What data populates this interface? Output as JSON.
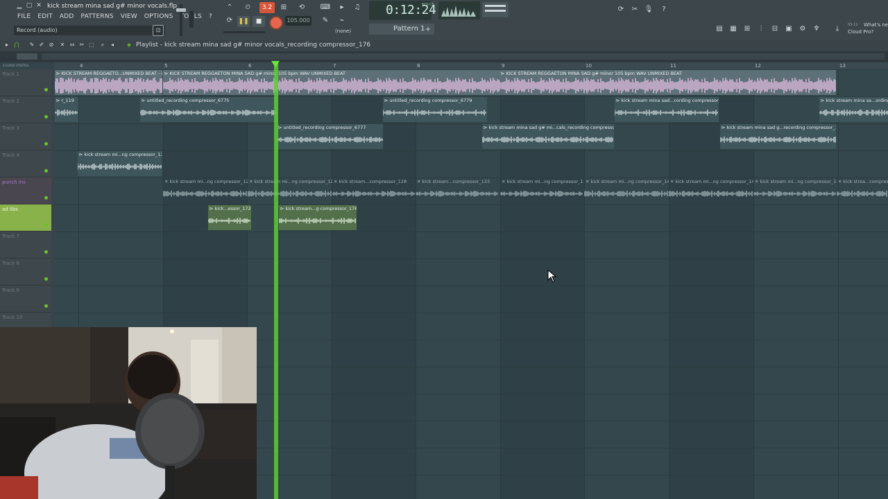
{
  "window": {
    "title": "kick stream mina sad g# minor vocals.flp"
  },
  "menu": [
    "FILE",
    "EDIT",
    "ADD",
    "PATTERNS",
    "VIEW",
    "OPTIONS",
    "TOOLS",
    "?"
  ],
  "hint": "Record (audio)",
  "transport": {
    "time": "0:12:24",
    "time_label": "M:S:CS",
    "tempo": "105.000",
    "snap_value": "3.2",
    "pattern": "Pattern 1",
    "pattern_snap": "(none)"
  },
  "news": {
    "date": "03-11",
    "line1": "What's new",
    "line2": "Cloud Pro?"
  },
  "playlist": {
    "title": "Playlist - kick stream mina sad g# minor vocals_recording compressor_176",
    "bar_numbers": [
      "4",
      "5",
      "6",
      "7",
      "8",
      "9",
      "10",
      "11",
      "12",
      "13"
    ],
    "tracks": [
      {
        "name": "Track 1"
      },
      {
        "name": "Track 2"
      },
      {
        "name": "Track 3"
      },
      {
        "name": "Track 4"
      },
      {
        "name": "punch ins"
      },
      {
        "name": "ad libs"
      },
      {
        "name": "Track 7"
      },
      {
        "name": "Track 8"
      },
      {
        "name": "Track 9"
      },
      {
        "name": "Track 10"
      }
    ],
    "clips": [
      {
        "label": "KICK STREAM REGGAETO...UNMIXED BEAT - intro"
      },
      {
        "label": "KICK STREAM REGGAETON MINA SAD g# minor 105 bpm WAV UNMIXED BEAT"
      },
      {
        "label": "KICK STREAM REGGAETON MINA SAD g# minor 105 bpm WAV UNMIXED BEAT"
      },
      {
        "label": "r_119"
      },
      {
        "label": "untitled_recording compressor_6775"
      },
      {
        "label": "untitled_recording compressor_6779"
      },
      {
        "label": "kick stream mina sad...cording compressor_14"
      },
      {
        "label": "kick stream mina sa...ording c"
      },
      {
        "label": "untitled_recording compressor_6777"
      },
      {
        "label": "kick stream mina sad g# mi...cals_recording compressor_4"
      },
      {
        "label": "kick stream mina sad g...recording compressor_17"
      },
      {
        "label": "kick stream mi...ng compressor_120"
      },
      {
        "label": "kick stream mi...ng compressor_121"
      },
      {
        "label": "kick stream mi...ng compressor_122"
      },
      {
        "label": "kick stream...compressor_128"
      },
      {
        "label": "kick stream...compressor_133"
      },
      {
        "label": "kick stream mi...ng compressor_135"
      },
      {
        "label": "kick stream mi...ng compressor_141"
      },
      {
        "label": "kick stream mi...ng compressor_142"
      },
      {
        "label": "kick stream mi...ng compressor_14"
      },
      {
        "label": "kick strea...compressor"
      },
      {
        "label": "kick...essor_172"
      },
      {
        "label": "kick stream...g compressor_176"
      }
    ]
  }
}
